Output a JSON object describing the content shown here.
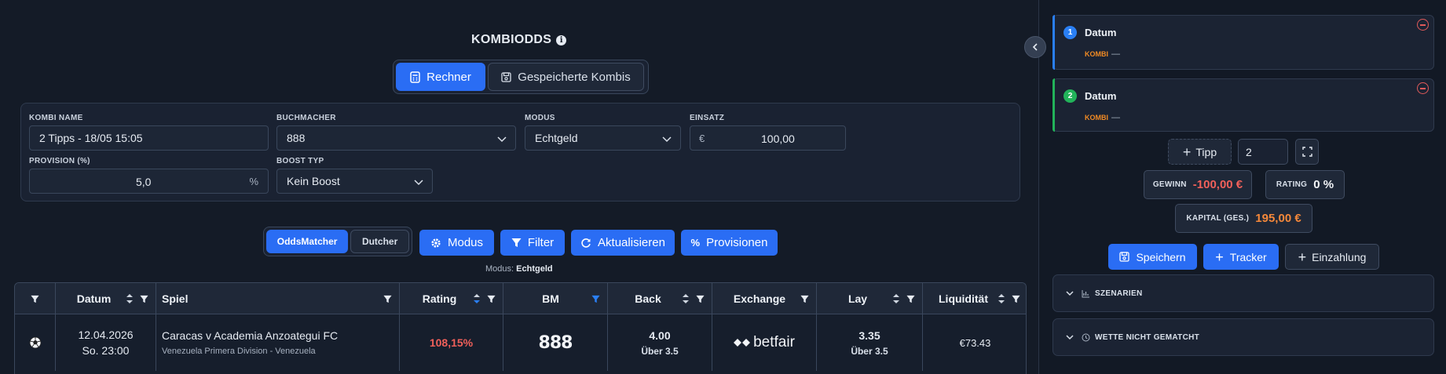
{
  "header": {
    "title": "KOMBIODDS",
    "info_icon": "info-icon"
  },
  "tabs": [
    {
      "label": "Rechner",
      "icon": "calculator-icon",
      "active": true
    },
    {
      "label": "Gespeicherte Kombis",
      "icon": "save-icon",
      "active": false
    }
  ],
  "form": {
    "kombi_name": {
      "label": "KOMBI NAME",
      "value": "2 Tipps - 18/05 15:05"
    },
    "buchmacher": {
      "label": "BUCHMACHER",
      "value": "888"
    },
    "modus": {
      "label": "MODUS",
      "value": "Echtgeld"
    },
    "einsatz": {
      "label": "EINSATZ",
      "currency": "€",
      "value": "100,00"
    },
    "provision": {
      "label": "PROVISION (%)",
      "value": "5,0",
      "unit": "%"
    },
    "boost_typ": {
      "label": "BOOST TYP",
      "value": "Kein Boost"
    }
  },
  "toolbar": {
    "mode_toggle": [
      {
        "label": "OddsMatcher",
        "active": true
      },
      {
        "label": "Dutcher",
        "active": false
      }
    ],
    "modus_label": "Modus",
    "filter_label": "Filter",
    "refresh_label": "Aktualisieren",
    "provisions_label": "Provisionen",
    "modus_prefix": "Modus:",
    "modus_value": "Echtgeld"
  },
  "table": {
    "columns": [
      "",
      "Datum",
      "Spiel",
      "Rating",
      "BM",
      "Back",
      "Exchange",
      "Lay",
      "Liquidität"
    ],
    "rows": [
      {
        "sport_icon": "soccer-ball-icon",
        "date": "12.04.2026",
        "time": "So. 23:00",
        "match": "Caracas v Academia Anzoategui FC",
        "league": "Venezuela Primera Division - Venezuela",
        "rating": "108,15%",
        "bookmaker": "888",
        "back_odds": "4.00",
        "back_market": "Über 3.5",
        "exchange": "betfair",
        "lay_odds": "3.35",
        "lay_market": "Über 3.5",
        "liquidity": "€73.43"
      }
    ]
  },
  "sidebar": {
    "tips": [
      {
        "number": "1",
        "title": "Datum",
        "kombi": "KOMBI",
        "dash": "—",
        "color": "#2a7ff4"
      },
      {
        "number": "2",
        "title": "Datum",
        "kombi": "KOMBI",
        "dash": "—",
        "color": "#22b35a"
      }
    ],
    "add_tip_label": "Tipp",
    "tip_count": "2",
    "gewinn_label": "GEWINN",
    "gewinn_value": "-100,00 €",
    "rating_label": "RATING",
    "rating_value": "0 %",
    "kapital_label": "KAPITAL (GES.)",
    "kapital_value": "195,00 €",
    "save_label": "Speichern",
    "tracker_label": "Tracker",
    "einzahlung_label": "Einzahlung",
    "szenarien_label": "SZENARIEN",
    "nicht_gematcht_label": "WETTE NICHT GEMATCHT"
  },
  "colors": {
    "accent": "#2a6df4",
    "negative": "#f0605a",
    "kapital": "#f5883a",
    "orange": "#f08a24"
  }
}
